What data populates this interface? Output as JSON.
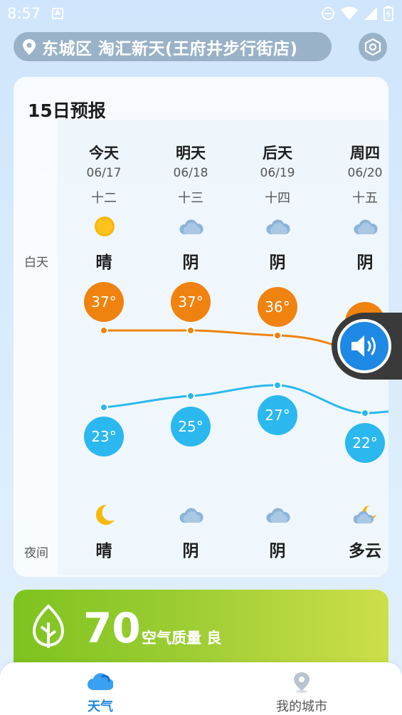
{
  "status": {
    "time": "8:57",
    "badge": "A"
  },
  "location": {
    "text": "东城区 淘汇新天(王府井步行街店)"
  },
  "forecast": {
    "title": "15日预报",
    "day_label": "白天",
    "night_label": "夜间",
    "days": [
      {
        "day": "今天",
        "date": "06/17",
        "lunar": "十二",
        "day_weather": "晴",
        "day_icon": "sun-icon",
        "high": "37°",
        "low": "23°",
        "night_weather": "晴",
        "night_icon": "moon-icon"
      },
      {
        "day": "明天",
        "date": "06/18",
        "lunar": "十三",
        "day_weather": "阴",
        "day_icon": "cloud-icon",
        "high": "37°",
        "low": "25°",
        "night_weather": "阴",
        "night_icon": "cloud-icon"
      },
      {
        "day": "后天",
        "date": "06/19",
        "lunar": "十四",
        "day_weather": "阴",
        "day_icon": "cloud-icon",
        "high": "36°",
        "low": "27°",
        "night_weather": "阴",
        "night_icon": "cloud-icon"
      },
      {
        "day": "周四",
        "date": "06/20",
        "lunar": "十五",
        "day_weather": "阴",
        "day_icon": "cloud-icon",
        "high": "",
        "low": "22°",
        "night_weather": "多云",
        "night_icon": "partly-cloudy-night-icon"
      }
    ],
    "colors": {
      "high": "#f0820f",
      "low": "#2ab8ef"
    }
  },
  "air_quality": {
    "value": "70",
    "label": "空气质量 良"
  },
  "nav": {
    "weather": "天气",
    "my_cities": "我的城市",
    "active_color": "#1e88e5"
  }
}
